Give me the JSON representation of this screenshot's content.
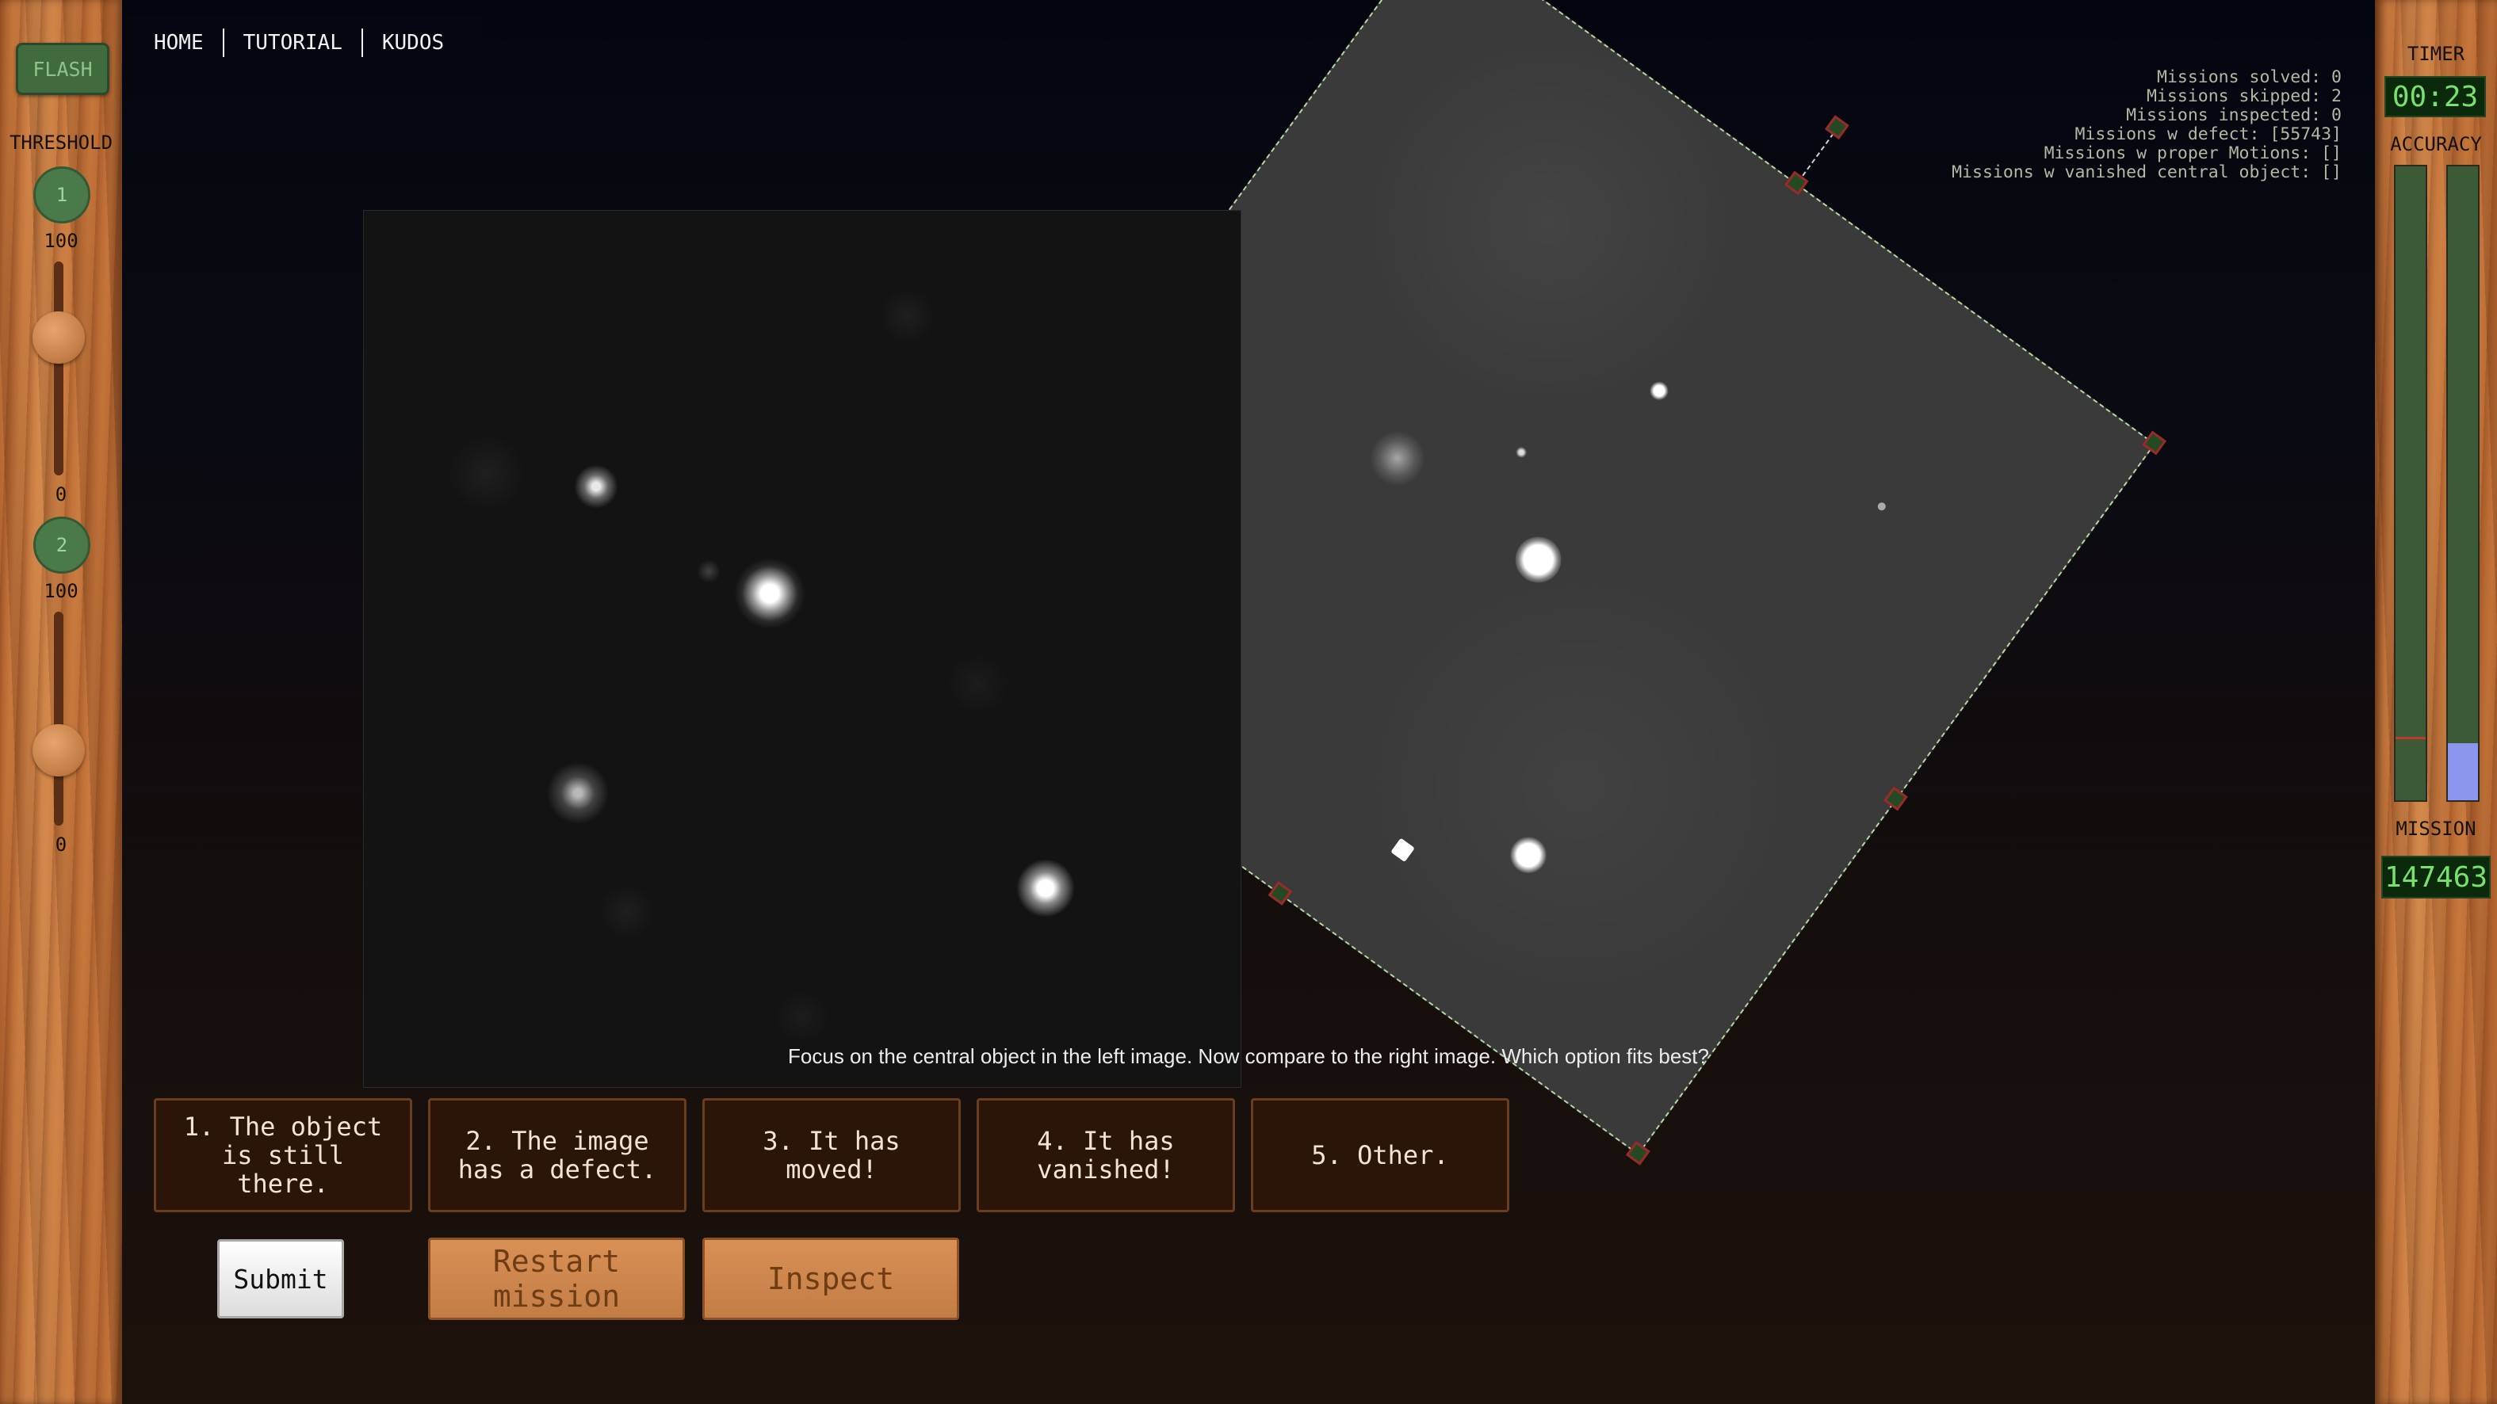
{
  "nav": {
    "home": "HOME",
    "tutorial": "TUTORIAL",
    "kudos": "KUDOS"
  },
  "left_panel": {
    "flash_label": "FLASH",
    "threshold_label": "THRESHOLD",
    "channel1": {
      "label": "1",
      "max": "100",
      "min": "0"
    },
    "channel2": {
      "label": "2",
      "max": "100",
      "min": "0"
    }
  },
  "right_panel": {
    "timer_label": "TIMER",
    "timer_value": "00:23",
    "accuracy_label": "ACCURACY",
    "mission_label": "MISSION",
    "mission_value": "147463"
  },
  "stats": [
    "Missions solved: 0",
    "Missions skipped: 2",
    "Missions inspected: 0",
    "Missions w defect: [55743]",
    "Missions w proper Motions: []",
    "Missions w vanished central object: []"
  ],
  "instruction": "Focus on the central object in the left image. Now compare to the right image. Which option fits best?",
  "options": [
    "1. The object is still there.",
    "2. The image has a defect.",
    "3. It has moved!",
    "4. It has vanished!",
    "5. Other."
  ],
  "buttons": {
    "submit": "Submit",
    "restart": "Restart mission",
    "inspect": "Inspect"
  },
  "colors": {
    "lcd_text": "#79e06f",
    "option_bg": "#2a1508",
    "accuracy_bar": "#8c96ee"
  }
}
